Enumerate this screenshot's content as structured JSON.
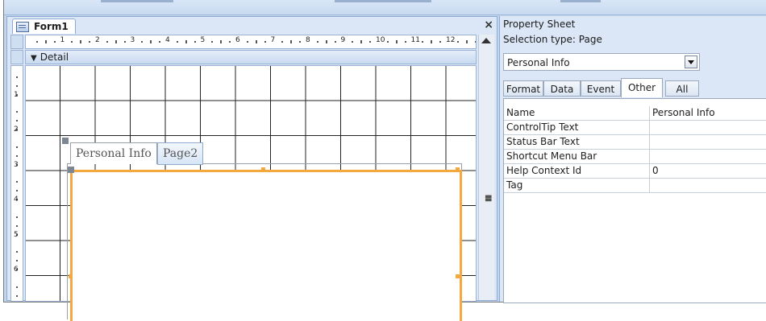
{
  "form": {
    "tab_title": "Form1",
    "close_glyph": "×",
    "section_label": "Detail",
    "ruler_numbers": [
      "1",
      "2",
      "3",
      "4",
      "5",
      "6",
      "7",
      "8",
      "9",
      "10",
      "11",
      "12"
    ],
    "vruler_numbers": [
      "1",
      "2",
      "3",
      "4",
      "5",
      "6"
    ],
    "tabs": [
      "Personal Info",
      "Page2"
    ]
  },
  "property_sheet": {
    "title": "Property Sheet",
    "selection_type_label": "Selection type:",
    "selection_type_value": "Page",
    "selected_object": "Personal Info",
    "tabs": [
      "Format",
      "Data",
      "Event",
      "Other",
      "All"
    ],
    "active_tab": "Other",
    "rows": [
      {
        "name": "Name",
        "value": "Personal Info"
      },
      {
        "name": "ControlTip Text",
        "value": ""
      },
      {
        "name": "Status Bar Text",
        "value": ""
      },
      {
        "name": "Shortcut Menu Bar",
        "value": ""
      },
      {
        "name": "Help Context Id",
        "value": "0"
      },
      {
        "name": "Tag",
        "value": ""
      }
    ]
  },
  "colors": {
    "selection_accent": "#f4a940",
    "office_blue": "#c3d5ec"
  },
  "icons": {
    "form": "form-icon",
    "close": "close-icon",
    "section_arrow": "section-arrow-icon",
    "dropdown": "dropdown-arrow-icon",
    "scroll_up": "scroll-up-arrow-icon"
  }
}
